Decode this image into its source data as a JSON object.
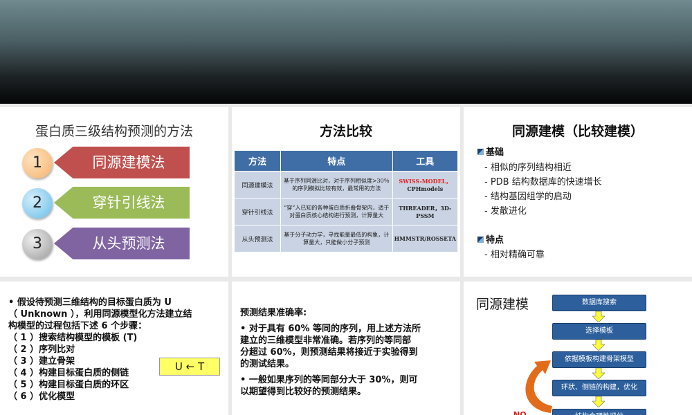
{
  "slide1": {
    "title": "蛋白质三级结构预测的方法",
    "methods": [
      {
        "num": "1",
        "label": "同源建模法",
        "color": "#c0504d",
        "circle": "#f6b26b"
      },
      {
        "num": "2",
        "label": "穿针引线法",
        "color": "#9bbb59",
        "circle": "#66bde8"
      },
      {
        "num": "3",
        "label": "从头预测法",
        "color": "#8064a2",
        "circle": "#b0b0b0"
      }
    ]
  },
  "slide2": {
    "title": "方法比较",
    "headers": [
      "方法",
      "特点",
      "工具"
    ],
    "rows": [
      {
        "method": "同源建模法",
        "feature": "基于序列同源比对，对于序列相似度>30％的序列模拟比较有效，最常用的方法",
        "tool_red": "SWISS-MODEL，",
        "tool": "CPHmodels"
      },
      {
        "method": "穿针引线法",
        "feature": "“穿”入已知的各种蛋白质折叠骨架内，适于对蛋白质核心结构进行预测，计算量大",
        "tool_red": "",
        "tool": "THREADER，3D-PSSM"
      },
      {
        "method": "从头预测法",
        "feature": "基于分子动力学，寻找能量最低的构象，计算量大，只能做小分子预测",
        "tool_red": "",
        "tool": "HMMSTR/ROSSETA"
      }
    ]
  },
  "slide3": {
    "title": "同源建模（比较建模）",
    "basis_label": "基础",
    "basis": [
      "-  相似的序列结构相近",
      "-  PDB 结构数据库的快速增长",
      "-   结构基因组学的启动",
      "-   发散进化"
    ],
    "feature_label": "特点",
    "features": [
      "-   相对精确可靠"
    ]
  },
  "slide4": {
    "lines": [
      "• 假设待预测三维结构的目标蛋白质为 U",
      "   （ Unknown ），利用同源模型化方法建立结",
      "   构模型的过程包括下述 6 个步骤：",
      "        （ 1 ）搜索结构模型的模板 (T)",
      "        （ 2 ）序列比对",
      "        （ 3 ）建立骨架",
      "        （ 4 ）构建目标蛋白质的侧链",
      "        （ 5 ）构建目标蛋白质的环区",
      "        （ 6 ）优化模型"
    ],
    "ut_label": "U  ←  T"
  },
  "slide5": {
    "heading": "预测结果准确率:",
    "bullets": [
      "•    对于具有 60% 等同的序列，用上述方法所",
      "     建立的三维模型非常准确。若序列的等同部",
      "     分超过 60%，则预测结果将接近于实验得到",
      "     的测试结果。",
      "•    一般如果序列的等同部分大于 30%，则可",
      "     以期望得到比较好的预测结果。"
    ]
  },
  "slide6": {
    "title": "同源建模",
    "steps": [
      "数据库搜索",
      "选择模板",
      "依据模板构建骨架模型",
      "环状、侧链的构建，优化",
      "结构合理性评估"
    ],
    "no_label": "NO",
    "arrow_color": "#e36c1b",
    "box_color": "#2c5f9c"
  }
}
